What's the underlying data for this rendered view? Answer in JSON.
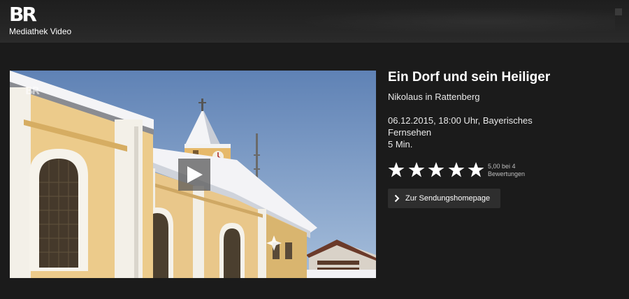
{
  "header": {
    "logo_mark": "BR",
    "logo_subtitle": "Mediathek Video"
  },
  "video": {
    "watermark": "BR",
    "play_icon": "play-icon"
  },
  "episode": {
    "title": "Ein Dorf und sein Heiliger",
    "subtitle": "Nikolaus in Rattenberg",
    "broadcast": "06.12.2015, 18:00 Uhr, Bayerisches Fernsehen",
    "duration": "5 Min."
  },
  "rating": {
    "stars_filled": 5,
    "stars_total": 5,
    "score_line": "5,00 bei 4",
    "count_line": "Bewertungen"
  },
  "homepage_button": {
    "icon": "chevron-right-icon",
    "label": "Zur Sendungshomepage"
  },
  "colors": {
    "background": "#1b1b1b",
    "header": "#252525",
    "button": "#2e2e2e",
    "text": "#ffffff"
  }
}
